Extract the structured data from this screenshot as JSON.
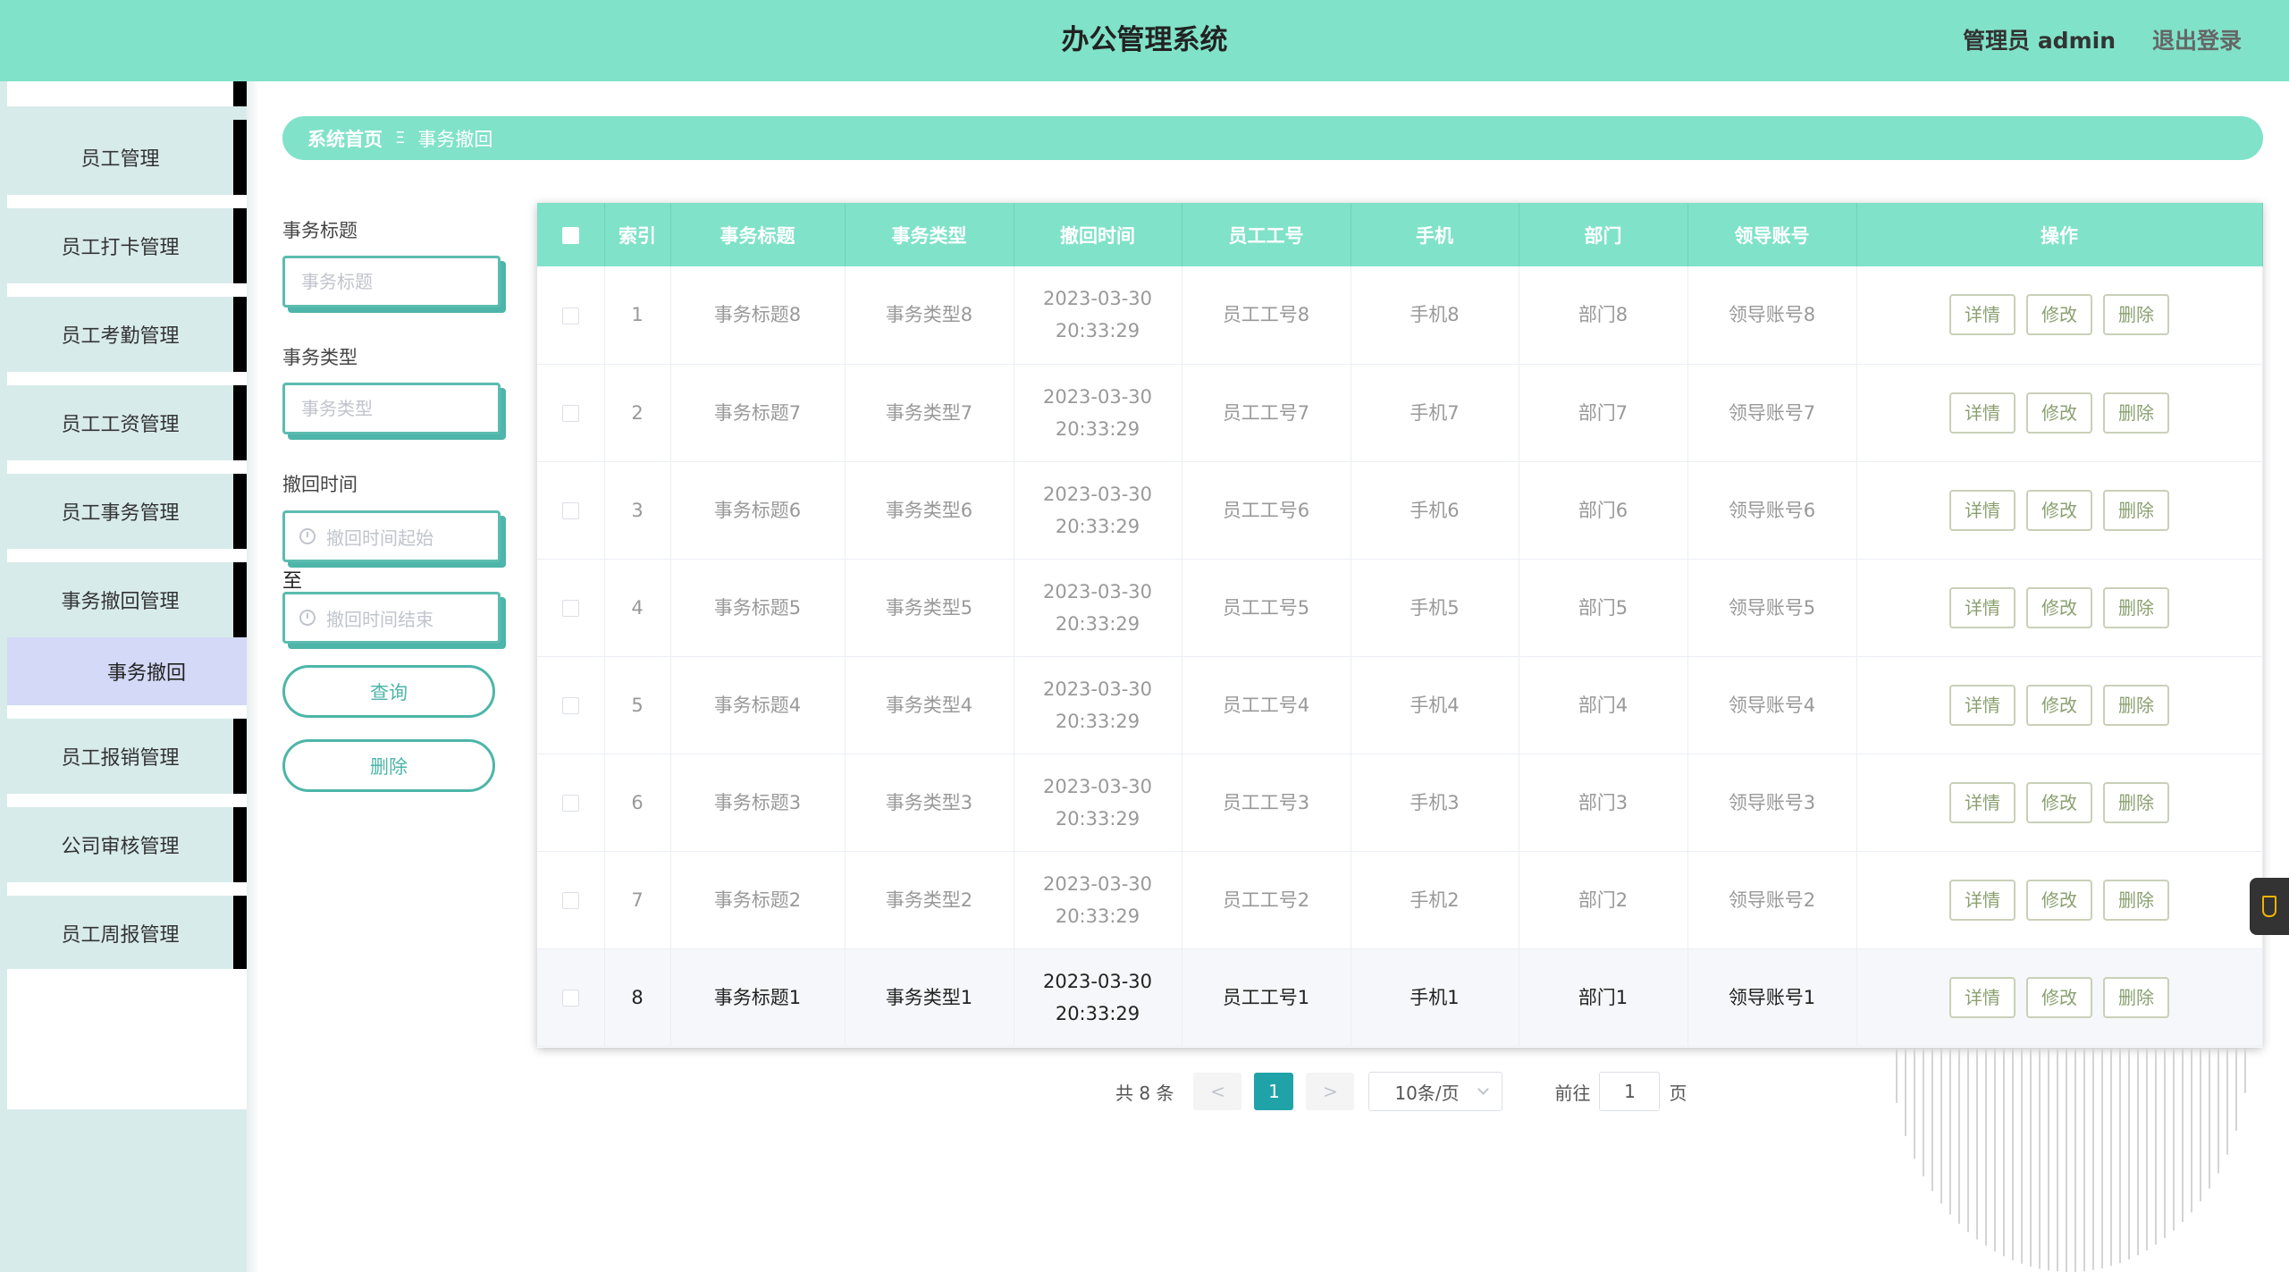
{
  "header": {
    "title": "办公管理系统",
    "admin": "管理员 admin",
    "logout": "退出登录"
  },
  "sidebar": {
    "items": [
      "员工管理",
      "员工打卡管理",
      "员工考勤管理",
      "员工工资管理",
      "员工事务管理",
      "事务撤回管理"
    ],
    "submenu": "事务撤回",
    "items_after": [
      "员工报销管理",
      "公司审核管理",
      "员工周报管理"
    ]
  },
  "breadcrumb": {
    "home": "系统首页",
    "sep": "Ξ",
    "current": "事务撤回"
  },
  "search": {
    "title_label": "事务标题",
    "title_placeholder": "事务标题",
    "type_label": "事务类型",
    "type_placeholder": "事务类型",
    "time_label": "撤回时间",
    "time_start": "撤回时间起始",
    "to": "至",
    "time_end": "撤回时间结束",
    "query_btn": "查询",
    "delete_btn": "删除"
  },
  "table": {
    "headers": [
      "索引",
      "事务标题",
      "事务类型",
      "撤回时间",
      "员工工号",
      "手机",
      "部门",
      "领导账号",
      "操作"
    ],
    "rows": [
      {
        "index": "1",
        "title": "事务标题8",
        "type": "事务类型8",
        "time": "2023-03-30 20:33:29",
        "emp": "员工工号8",
        "phone": "手机8",
        "dept": "部门8",
        "leader": "领导账号8"
      },
      {
        "index": "2",
        "title": "事务标题7",
        "type": "事务类型7",
        "time": "2023-03-30 20:33:29",
        "emp": "员工工号7",
        "phone": "手机7",
        "dept": "部门7",
        "leader": "领导账号7"
      },
      {
        "index": "3",
        "title": "事务标题6",
        "type": "事务类型6",
        "time": "2023-03-30 20:33:29",
        "emp": "员工工号6",
        "phone": "手机6",
        "dept": "部门6",
        "leader": "领导账号6"
      },
      {
        "index": "4",
        "title": "事务标题5",
        "type": "事务类型5",
        "time": "2023-03-30 20:33:29",
        "emp": "员工工号5",
        "phone": "手机5",
        "dept": "部门5",
        "leader": "领导账号5"
      },
      {
        "index": "5",
        "title": "事务标题4",
        "type": "事务类型4",
        "time": "2023-03-30 20:33:29",
        "emp": "员工工号4",
        "phone": "手机4",
        "dept": "部门4",
        "leader": "领导账号4"
      },
      {
        "index": "6",
        "title": "事务标题3",
        "type": "事务类型3",
        "time": "2023-03-30 20:33:29",
        "emp": "员工工号3",
        "phone": "手机3",
        "dept": "部门3",
        "leader": "领导账号3"
      },
      {
        "index": "7",
        "title": "事务标题2",
        "type": "事务类型2",
        "time": "2023-03-30 20:33:29",
        "emp": "员工工号2",
        "phone": "手机2",
        "dept": "部门2",
        "leader": "领导账号2"
      },
      {
        "index": "8",
        "title": "事务标题1",
        "type": "事务类型1",
        "time": "2023-03-30 20:33:29",
        "emp": "员工工号1",
        "phone": "手机1",
        "dept": "部门1",
        "leader": "领导账号1"
      }
    ],
    "actions": {
      "detail": "详情",
      "edit": "修改",
      "delete": "删除"
    }
  },
  "pagination": {
    "total": "共 8 条",
    "prev": "<",
    "page": "1",
    "next": ">",
    "size": "10条/页",
    "goto_label": "前往",
    "goto_value": "1",
    "goto_suffix": "页"
  },
  "colors": {
    "accent": "#80e2c9",
    "accent_dark": "#4db5a9",
    "page_active": "#1fa3a8",
    "submenu_bg": "#d3d9f6"
  }
}
